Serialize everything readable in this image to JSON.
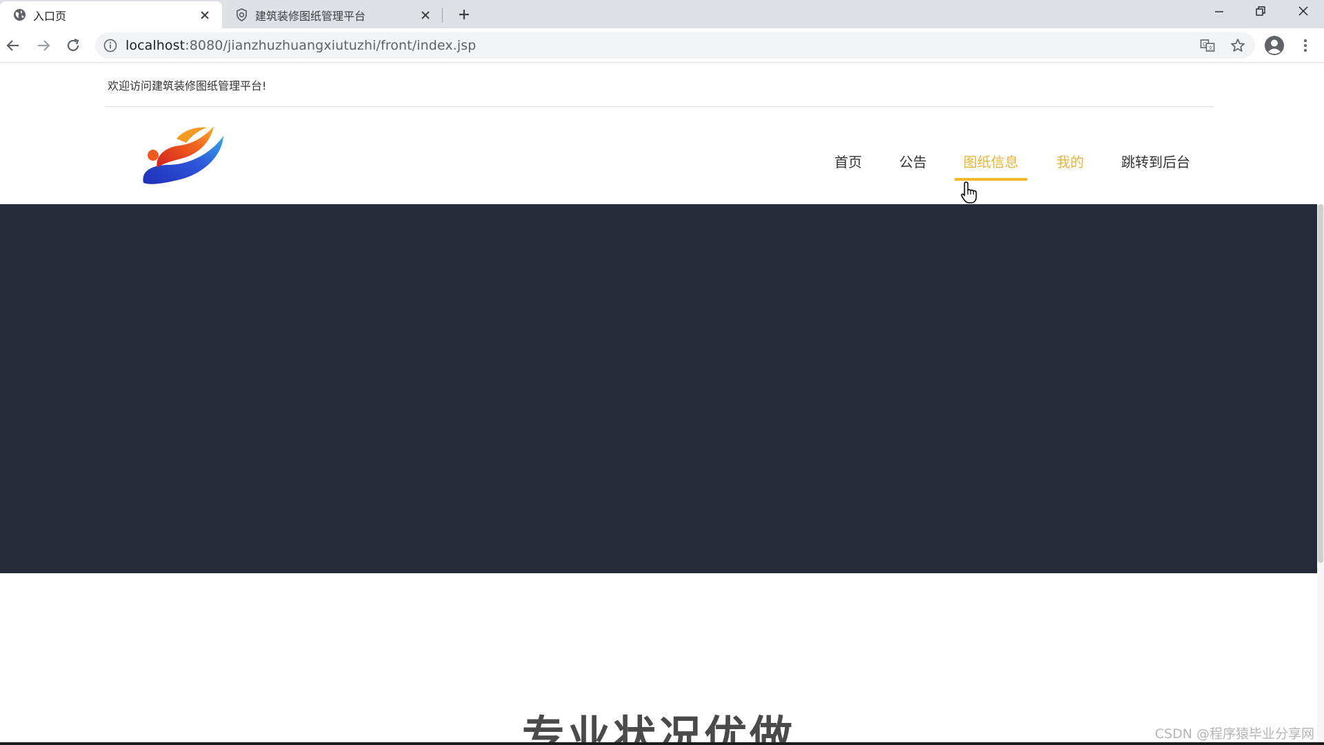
{
  "browser": {
    "tabs": [
      {
        "title": "入口页",
        "active": true
      },
      {
        "title": "建筑装修图纸管理平台",
        "active": false
      }
    ],
    "address": {
      "host": "localhost",
      "path": ":8080/jianzhuzhuangxiutuzhi/front/index.jsp"
    },
    "icons": {
      "back": "back-arrow-icon",
      "forward": "forward-arrow-icon",
      "reload": "reload-icon",
      "info": "info-icon",
      "translate": "translate-icon",
      "bookmark": "star-icon",
      "profile": "profile-icon",
      "menu": "more-vert-icon"
    }
  },
  "site": {
    "welcome": "欢迎访问建筑装修图纸管理平台!",
    "nav": [
      {
        "label": "首页",
        "state": "normal"
      },
      {
        "label": "公告",
        "state": "normal"
      },
      {
        "label": "图纸信息",
        "state": "active"
      },
      {
        "label": "我的",
        "state": "highlight"
      },
      {
        "label": "跳转到后台",
        "state": "normal"
      }
    ],
    "banner_color": "#252b36",
    "accent_color": "#f0b928",
    "section_heading": "专业状况优做",
    "watermark": "CSDN @程序猿毕业分享网"
  }
}
